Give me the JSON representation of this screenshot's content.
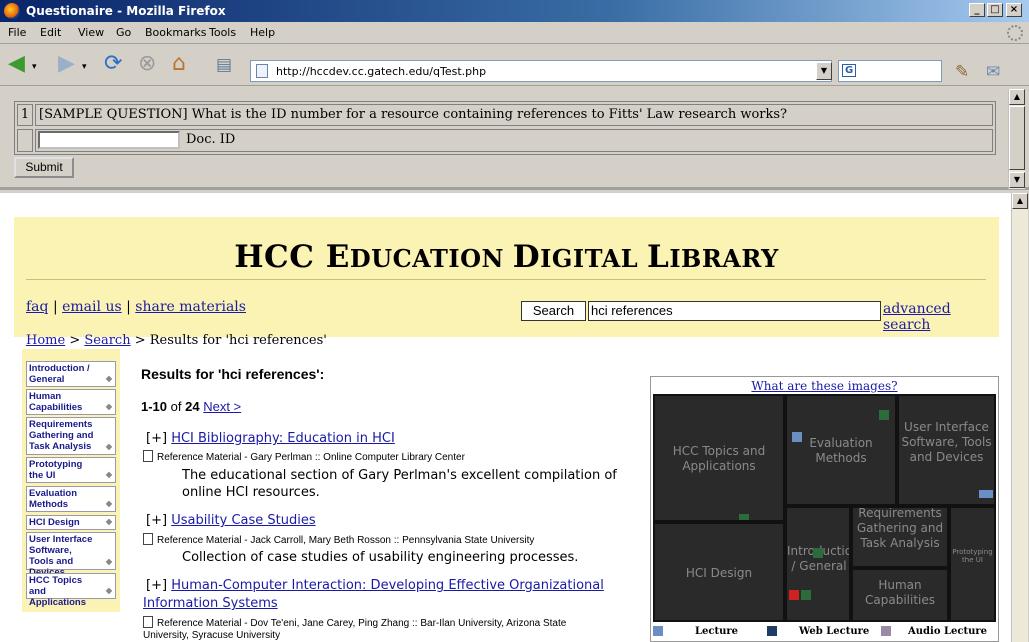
{
  "window": {
    "title": "Questionaire - Mozilla Firefox"
  },
  "menu": [
    "File",
    "Edit",
    "View",
    "Go",
    "Bookmarks",
    "Tools",
    "Help"
  ],
  "address": {
    "url": "http://hccdev.cc.gatech.edu/qTest.php"
  },
  "questionnaire": {
    "number": "1",
    "question": "[SAMPLE QUESTION] What is the ID number for a resource containing references to Fitts' Law research works?",
    "answer_value": "",
    "answer_label": "Doc. ID",
    "submit_label": "Submit"
  },
  "site": {
    "title": "HCC Education Digital Library",
    "links": {
      "faq": "faq",
      "email": "email us",
      "share": "share materials"
    },
    "search_label": "Search",
    "search_value": "hci references",
    "advanced": "advanced search",
    "breadcrumb": {
      "home": "Home",
      "search": "Search",
      "current": "Results for 'hci references'"
    }
  },
  "sidebar": [
    "Introduction / General",
    "Human Capabilities",
    "Requirements Gathering and Task Analysis",
    "Prototyping the UI",
    "Evaluation Methods",
    "HCI Design",
    "User Interface Software, Tools and Devices",
    "HCC Topics and Applications"
  ],
  "results": {
    "heading": "Results for 'hci references':",
    "range": "1-10",
    "of": "of",
    "total": "24",
    "next": "Next >",
    "items": [
      {
        "toggle": "[+]",
        "title": "HCI Bibliography: Education in HCI",
        "meta": "Reference Material - Gary Perlman :: Online Computer Library Center",
        "desc1": "The educational section of Gary Perlman's excellent compilation of",
        "desc2": "online HCI resources."
      },
      {
        "toggle": "[+]",
        "title": "Usability Case Studies",
        "meta": "Reference Material - Jack Carroll, Mary Beth Rosson :: Pennsylvania State University",
        "desc1": "Collection of case studies of usability engineering processes."
      },
      {
        "toggle": "[+]",
        "title1": "Human-Computer Interaction: Developing Effective Organizational",
        "title2": "Information Systems",
        "meta": "Reference Material - Dov Te'eni, Jane Carey, Ping Zhang :: Bar-Ilan University, Arizona State",
        "meta2": "University, Syracuse University"
      }
    ]
  },
  "treemap": {
    "what": "What are these images?",
    "labels": {
      "hcc": "HCC Topics and Applications",
      "eval": "Evaluation Methods",
      "ui": "User Interface Software, Tools and Devices",
      "design": "HCI Design",
      "intro": "Introduction / General",
      "req": "Requirements Gathering and Task Analysis",
      "proto": "Prototyping the UI",
      "human": "Human Capabilities"
    },
    "legend": [
      {
        "label": "Lecture",
        "color": "#6b8fc2"
      },
      {
        "label": "Web Lecture",
        "color": "#1f3d66"
      },
      {
        "label": "Audio Lecture",
        "color": "#9a8aa8"
      }
    ]
  }
}
